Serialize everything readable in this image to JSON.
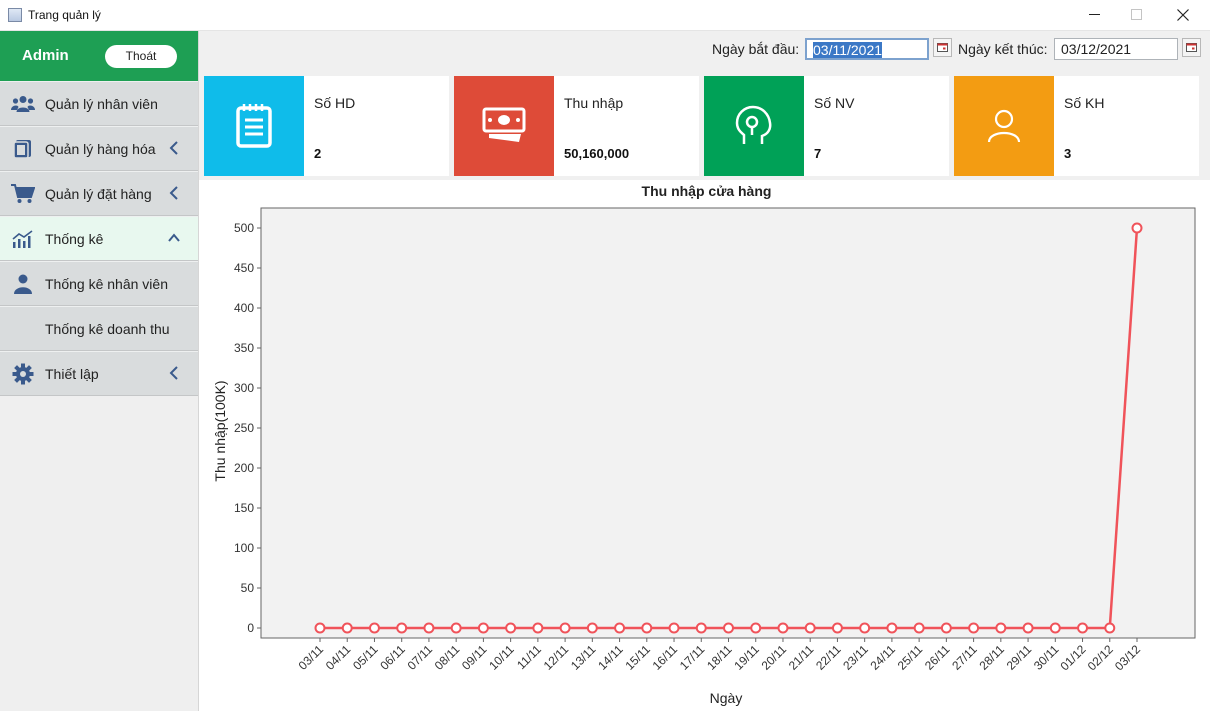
{
  "window": {
    "title": "Trang quản lý"
  },
  "sidebar": {
    "admin": "Admin",
    "logout": "Thoát",
    "items": [
      {
        "label": "Quản lý nhân viên",
        "icon": "users-icon",
        "chevron": ""
      },
      {
        "label": "Quản lý hàng hóa",
        "icon": "box-icon",
        "chevron": "left"
      },
      {
        "label": "Quản lý đặt hàng",
        "icon": "cart-icon",
        "chevron": "left"
      },
      {
        "label": "Thống kê",
        "icon": "chart-line-icon",
        "chevron": "up"
      },
      {
        "label": "Thống kê nhân viên",
        "icon": "user-icon",
        "chevron": ""
      },
      {
        "label": "Thống kê doanh thu",
        "icon": "",
        "chevron": ""
      },
      {
        "label": "Thiết lập",
        "icon": "gear-icon",
        "chevron": "left"
      }
    ]
  },
  "dates": {
    "start_label": "Ngày bắt đầu:",
    "start_value": "03/11/2021",
    "end_label": "Ngày kết thúc:",
    "end_value": "03/12/2021"
  },
  "cards": [
    {
      "title": "Số HD",
      "value": "2",
      "color": "#0fbcea",
      "icon": "receipt-icon"
    },
    {
      "title": "Thu nhập",
      "value": "50,160,000",
      "color": "#de4b38",
      "icon": "money-icon"
    },
    {
      "title": "Số NV",
      "value": "7",
      "color": "#00a157",
      "icon": "head-icon"
    },
    {
      "title": "Số KH",
      "value": "3",
      "color": "#f39c12",
      "icon": "user-outline-icon"
    }
  ],
  "chart_data": {
    "type": "line",
    "title": "Thu nhập cửa hàng",
    "xlabel": "Ngày",
    "ylabel": "Thu nhập(100K)",
    "ylim": [
      0,
      500
    ],
    "yticks": [
      0,
      50,
      100,
      150,
      200,
      250,
      300,
      350,
      400,
      450,
      500
    ],
    "categories": [
      "03/11",
      "04/11",
      "05/11",
      "06/11",
      "07/11",
      "08/11",
      "09/11",
      "10/11",
      "11/11",
      "12/11",
      "13/11",
      "14/11",
      "15/11",
      "16/11",
      "17/11",
      "18/11",
      "19/11",
      "20/11",
      "21/11",
      "22/11",
      "23/11",
      "24/11",
      "25/11",
      "26/11",
      "27/11",
      "28/11",
      "29/11",
      "30/11",
      "01/12",
      "02/12",
      "03/12"
    ],
    "values": [
      0,
      0,
      0,
      0,
      0,
      0,
      0,
      0,
      0,
      0,
      0,
      0,
      0,
      0,
      0,
      0,
      0,
      0,
      0,
      0,
      0,
      0,
      0,
      0,
      0,
      0,
      0,
      0,
      0,
      0,
      500
    ],
    "line_color": "#f0535a",
    "plot_background": "#f2f2f2",
    "grid": false
  }
}
